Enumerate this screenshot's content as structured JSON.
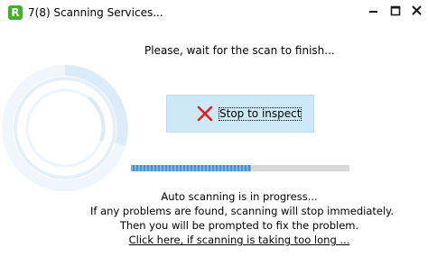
{
  "window": {
    "title": "7(8) Scanning Services...",
    "app_icon_letter": "R",
    "controls": [
      "minimize-icon",
      "maximize-icon",
      "close-icon"
    ]
  },
  "main": {
    "wait_message": "Please, wait for the scan to finish...",
    "stop_button_label": "Stop to inspect",
    "stop_button_icon": "red-x-icon",
    "progress_fraction": 0.55,
    "info_lines": [
      "Auto scanning is in progress...",
      "If any problems are found, scanning will stop immediately.",
      "Then you will be prompted to fix the problem."
    ],
    "long_scan_link": "Click here, if scanning is taking too long ..."
  },
  "colors": {
    "app_icon": "#43b02a",
    "button_background": "#cde8f7",
    "progress_fill": "#4d8fc9",
    "progress_track": "#d8d8d8",
    "stop_icon": "#e02020",
    "spinner": "#dcebf8"
  }
}
